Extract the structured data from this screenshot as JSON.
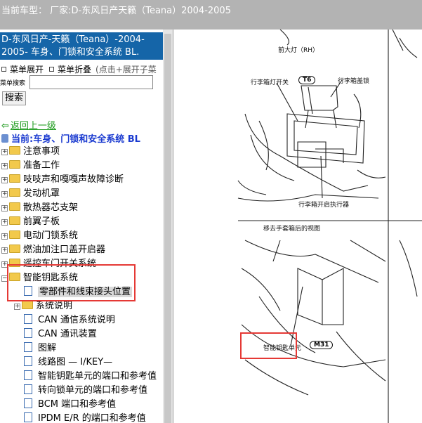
{
  "window": {
    "title": "当前车型： 厂家:D-东风日产天籁（Teana）2004-2005"
  },
  "left": {
    "header": "D-东风日产-天籁（Teana）-2004-2005- 车身、门锁和安全系统 BL.",
    "menu_expand": "菜单展开",
    "menu_collapse": "菜单折叠",
    "menu_note": "(点击+展开子菜",
    "search_label": "菜单搜索",
    "search_placeholder": "",
    "search_button": "搜索",
    "back_link": "返回上一级",
    "current": "当前:车身、门锁和安全系统 BL",
    "tree": [
      {
        "label": "注意事项",
        "type": "folder"
      },
      {
        "label": "准备工作",
        "type": "folder"
      },
      {
        "label": "吱吱声和嘎嘎声故障诊断",
        "type": "folder"
      },
      {
        "label": "发动机罩",
        "type": "folder"
      },
      {
        "label": "散热器芯支架",
        "type": "folder"
      },
      {
        "label": "前翼子板",
        "type": "folder"
      },
      {
        "label": "电动门锁系统",
        "type": "folder"
      },
      {
        "label": "燃油加注口盖开启器",
        "type": "folder"
      },
      {
        "label": "遥控车门开关系统",
        "type": "folder"
      },
      {
        "label": "智能钥匙系统",
        "type": "folder-open"
      },
      {
        "label": "零部件和线束接头位置",
        "type": "doc-selected"
      },
      {
        "label": "系统说明",
        "type": "subfolder"
      },
      {
        "label": "CAN 通信系统说明",
        "type": "doc"
      },
      {
        "label": "CAN 通讯装置",
        "type": "doc"
      },
      {
        "label": "图解",
        "type": "doc"
      },
      {
        "label": "线路图 — I/KEY—",
        "type": "doc"
      },
      {
        "label": "智能钥匙单元的端口和参考值",
        "type": "doc"
      },
      {
        "label": "转向锁单元的端口和参考值",
        "type": "doc"
      },
      {
        "label": "BCM 端口和参考值",
        "type": "doc"
      },
      {
        "label": "IPDM E/R 的端口和参考值",
        "type": "doc"
      }
    ]
  },
  "diagram": {
    "label_headlamp": "前大灯（RH）",
    "label_trunk_lamp_switch": "行李箱灯开关",
    "tag_t6": "T6",
    "label_trunk_lock": "行李箱盖锁",
    "label_trunk_actuator": "行李箱开启执行器",
    "label_glovebox_view": "移去手套箱后的视图",
    "label_ikey_unit": "智能钥匙单元",
    "tag_m31": "M31"
  },
  "colors": {
    "header_bg": "#1565a8",
    "highlight_box": "#e53935",
    "link_green": "#1a9a1a",
    "current_blue": "#1a3ad0"
  }
}
